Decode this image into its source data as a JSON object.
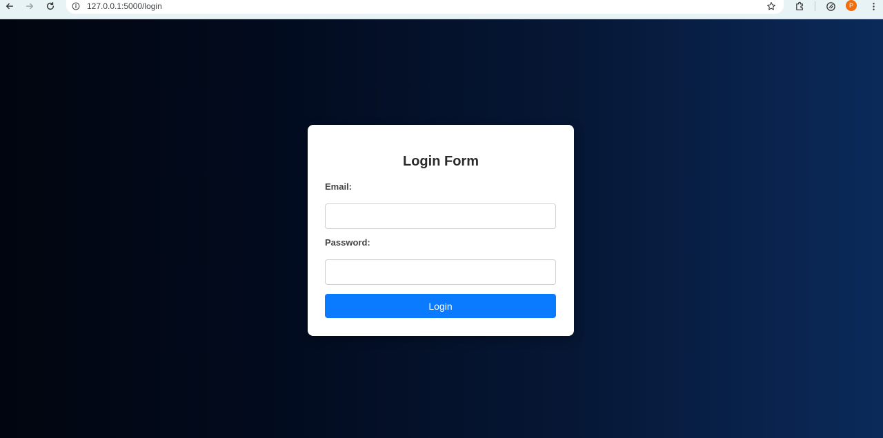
{
  "browser": {
    "url": "127.0.0.1:5000/login",
    "avatar_initial": "P",
    "icons": {
      "back": "arrow-left-icon",
      "forward": "arrow-right-icon",
      "reload": "reload-icon",
      "site_info": "info-icon",
      "bookmark": "star-icon",
      "extensions": "puzzle-icon",
      "sync": "sync-icon",
      "menu": "kebab-menu-icon"
    }
  },
  "login_form": {
    "title": "Login Form",
    "email_label": "Email:",
    "email_value": "",
    "password_label": "Password:",
    "password_value": "",
    "submit_label": "Login"
  },
  "colors": {
    "primary_button": "#0a7bff",
    "background_start": "#01050f",
    "background_end": "#0b2a5a",
    "avatar": "#f36c0c"
  }
}
